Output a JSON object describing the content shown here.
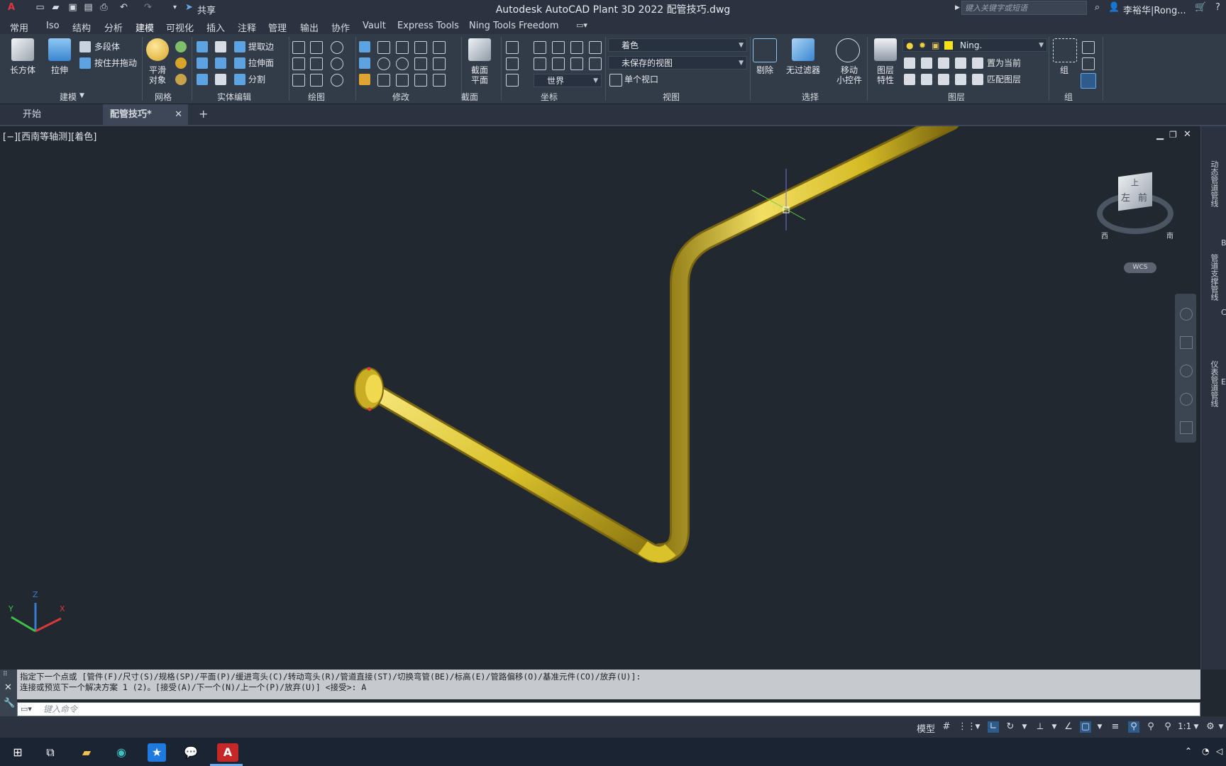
{
  "app": {
    "title": "Autodesk AutoCAD Plant 3D 2022    配管技巧.dwg",
    "share_label": "共享",
    "search_placeholder": "键入关键字或短语",
    "user_name": "李裕华|Rong..."
  },
  "ribbon_tabs": [
    "常用",
    "Iso",
    "结构",
    "分析",
    "建模",
    "可视化",
    "插入",
    "注释",
    "管理",
    "输出",
    "协作",
    "Vault",
    "Express Tools",
    "Ning Tools Freedom"
  ],
  "active_tab": "建模",
  "panels": {
    "modeling": {
      "label": "建模",
      "box": "长方体",
      "extrude": "拉伸",
      "polysolid": "多段体",
      "presspull": "按住并拖动"
    },
    "mesh": {
      "label": "网格",
      "smooth": "平滑\n对象"
    },
    "solid_edit": {
      "label": "实体编辑",
      "extract_edges": "提取边",
      "extrude_faces": "拉伸面",
      "separate": "分割"
    },
    "draw": {
      "label": "绘图"
    },
    "modify": {
      "label": "修改"
    },
    "section": {
      "label": "截面",
      "section_plane": "截面\n平面"
    },
    "coordinates": {
      "label": "坐标",
      "world": "世界"
    },
    "view": {
      "label": "视图",
      "visual_style": "着色",
      "named_view": "未保存的视图",
      "single_viewport": "单个视口"
    },
    "selection": {
      "label": "选择",
      "cull": "剔除",
      "no_filter": "无过滤器"
    },
    "gizmo": {
      "label": "移动\n小控件"
    },
    "layers": {
      "label": "图层",
      "layer_props": "图层\n特性",
      "current_layer": "Ning.",
      "set_current": "置为当前",
      "match_layer": "匹配图层"
    },
    "groups": {
      "label": "组",
      "group": "组"
    }
  },
  "doc_tabs": [
    {
      "label": "开始"
    },
    {
      "label": "配管技巧*"
    }
  ],
  "viewport": {
    "label": "[−][西南等轴测][着色]",
    "viewcube": {
      "top": "上",
      "left": "左",
      "front": "前",
      "west": "西",
      "south": "南",
      "wcs": "WCS"
    },
    "ucs": {
      "x": "X",
      "y": "Y",
      "z": "Z"
    },
    "pipe_color": "#d9c22a"
  },
  "palettes": [
    "动态管道管线",
    "管道支撑管线",
    "仪表管道管线"
  ],
  "palette_letters": [
    "B",
    "C",
    "E"
  ],
  "command": {
    "line1": "指定下一个点或 [管件(F)/尺寸(S)/规格(SP)/平面(P)/缓进弯头(C)/转动弯头(R)/管道直接(ST)/切换弯管(BE)/标高(E)/管路偏移(O)/基准元件(CO)/放弃(U)]:",
    "line2": "连接或预览下一个解决方案 1 (2)。[接受(A)/下一个(N)/上一个(P)/放弃(U)] <接受>: A",
    "input_placeholder": "键入命令"
  },
  "status": {
    "model": "模型",
    "scale": "1:1"
  }
}
